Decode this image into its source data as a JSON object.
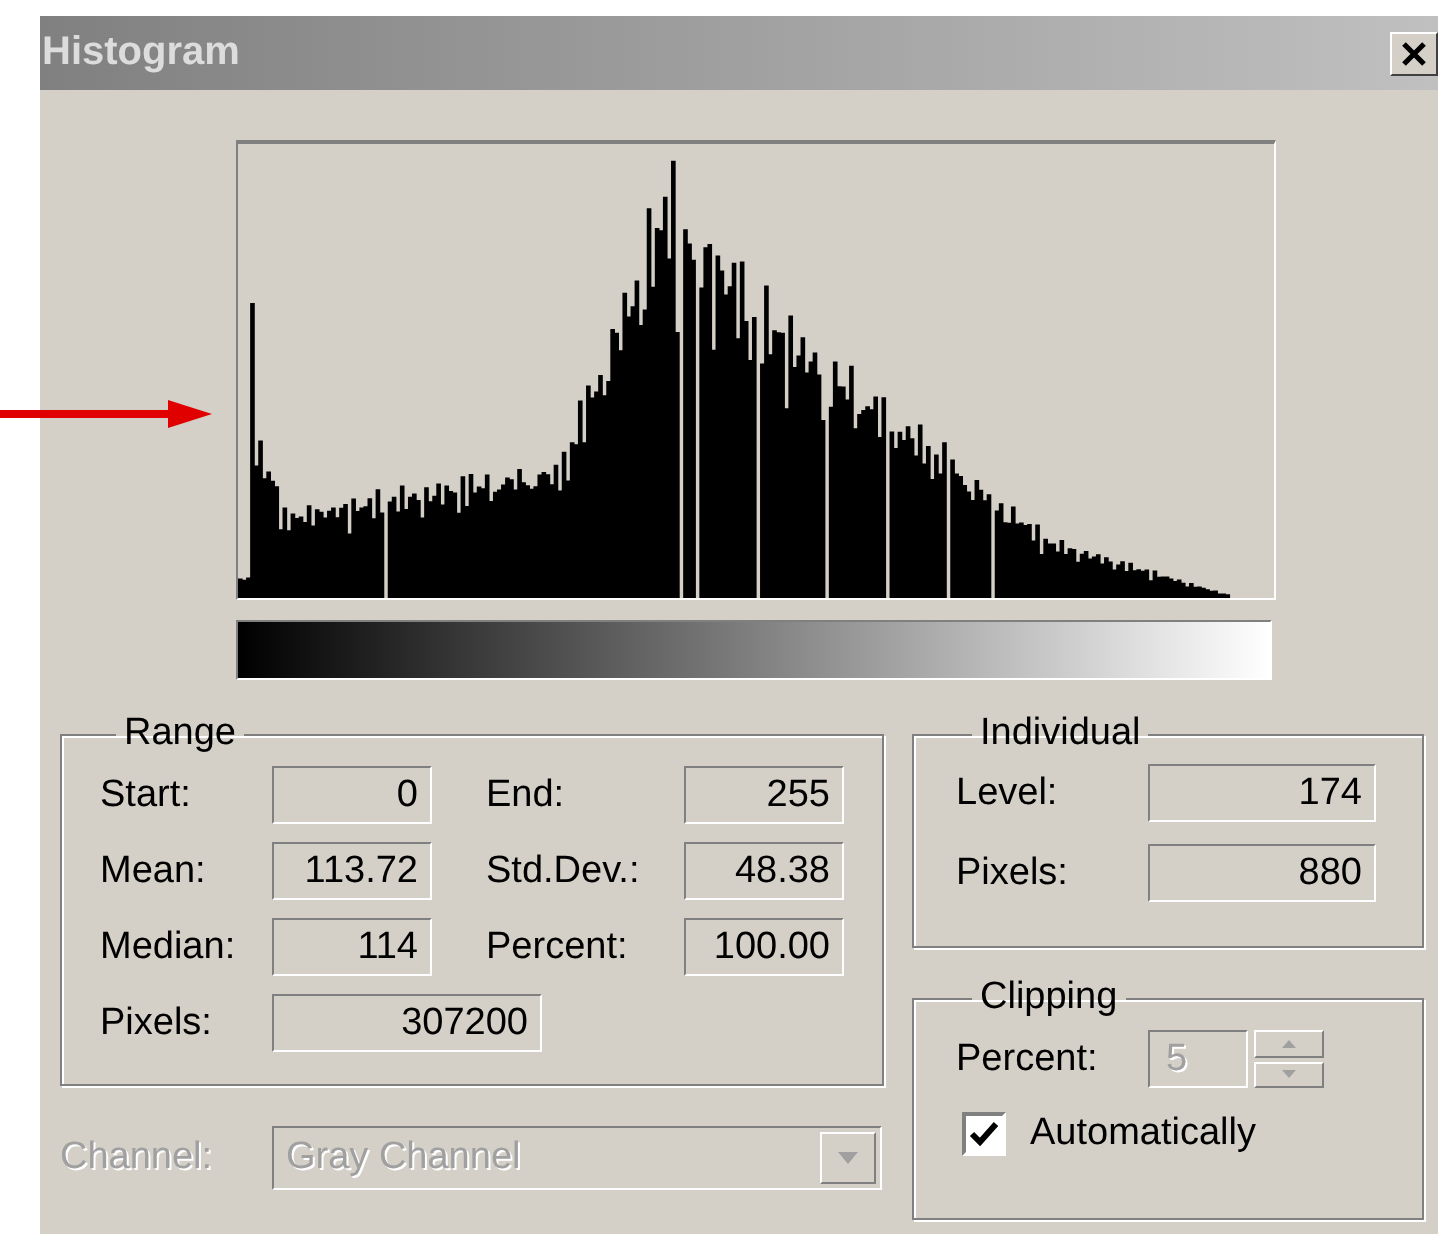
{
  "window": {
    "title": "Histogram"
  },
  "range": {
    "title": "Range",
    "fields": [
      {
        "label": "Start:",
        "value": "0"
      },
      {
        "label": "End:",
        "value": "255"
      },
      {
        "label": "Mean:",
        "value": "113.72"
      },
      {
        "label": "Std.Dev.:",
        "value": "48.38"
      },
      {
        "label": "Median:",
        "value": "114"
      },
      {
        "label": "Percent:",
        "value": "100.00"
      },
      {
        "label": "Pixels:",
        "value": "307200"
      }
    ]
  },
  "individual": {
    "title": "Individual",
    "fields": [
      {
        "label": "Level:",
        "value": "174"
      },
      {
        "label": "Pixels:",
        "value": "880"
      }
    ]
  },
  "clipping": {
    "title": "Clipping",
    "percent": {
      "label": "Percent:",
      "value": "5",
      "disabled": true
    },
    "automatic": {
      "label": "Automatically",
      "checked": true
    }
  },
  "channel": {
    "label": "Channel:",
    "value": "Gray Channel",
    "disabled": true
  }
}
